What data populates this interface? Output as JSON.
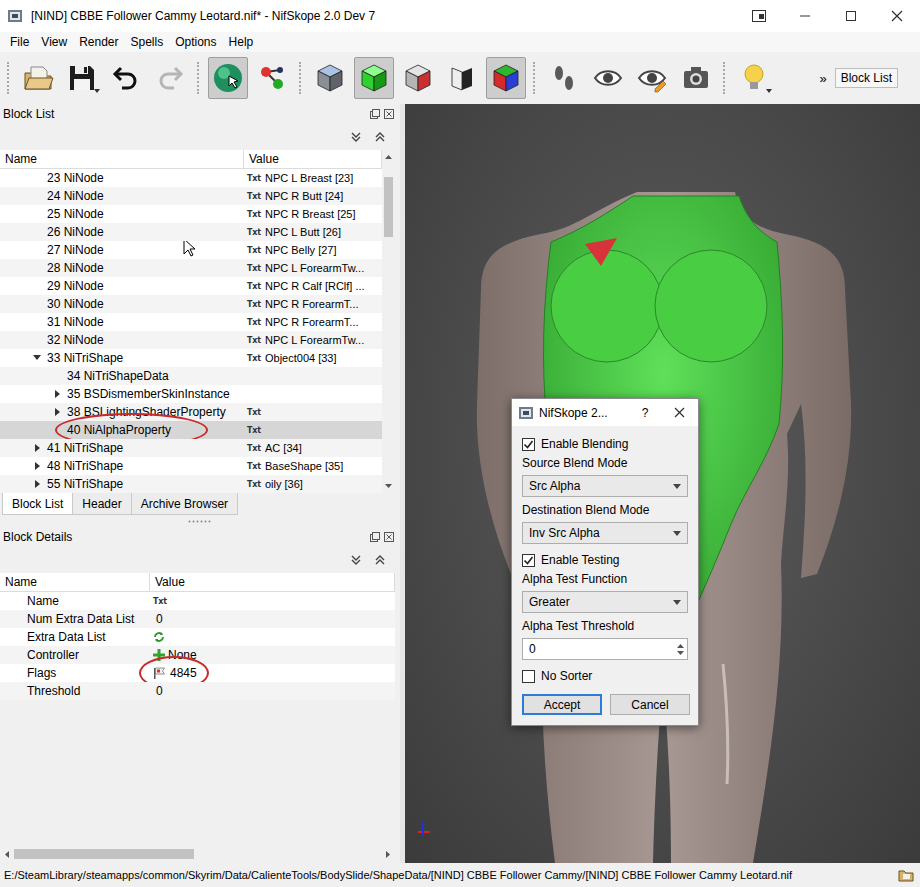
{
  "window": {
    "title": "[NIND] CBBE Follower Cammy Leotard.nif* - NifSkope 2.0 Dev 7"
  },
  "menu": [
    "File",
    "View",
    "Render",
    "Spells",
    "Options",
    "Help"
  ],
  "toolbar": {
    "items": [
      {
        "kind": "button",
        "pressed": false,
        "disabled": false
      },
      {
        "kind": "button",
        "pressed": false,
        "disabled": false
      },
      {
        "kind": "button",
        "pressed": false,
        "disabled": false
      },
      {
        "kind": "button",
        "pressed": false,
        "disabled": true
      },
      {
        "kind": "separator"
      },
      {
        "kind": "button",
        "pressed": true,
        "disabled": false
      },
      {
        "kind": "button",
        "pressed": false,
        "disabled": false
      },
      {
        "kind": "separator"
      },
      {
        "kind": "button",
        "pressed": false,
        "disabled": false
      },
      {
        "kind": "button",
        "pressed": true,
        "disabled": false
      },
      {
        "kind": "button",
        "pressed": false,
        "disabled": false
      },
      {
        "kind": "button",
        "pressed": false,
        "disabled": false
      },
      {
        "kind": "button",
        "pressed": true,
        "disabled": false
      },
      {
        "kind": "separator"
      },
      {
        "kind": "button",
        "pressed": false,
        "disabled": false
      },
      {
        "kind": "button",
        "pressed": false,
        "disabled": false
      },
      {
        "kind": "button",
        "pressed": false,
        "disabled": false
      },
      {
        "kind": "button",
        "pressed": false,
        "disabled": false
      },
      {
        "kind": "separator"
      },
      {
        "kind": "button",
        "pressed": false,
        "disabled": false
      }
    ],
    "overflow": "»",
    "dock_button": "Block List"
  },
  "block_list": {
    "title": "Block List",
    "columns": [
      "Name",
      "Value"
    ],
    "scroll_position": 0.05,
    "rows": [
      {
        "label": "23 NiNode",
        "value": "NPC L Breast [23]",
        "tag": "Txt",
        "depth": 1,
        "children": false,
        "selected": false,
        "highlighted": false
      },
      {
        "label": "24 NiNode",
        "value": "NPC R Butt [24]",
        "tag": "Txt",
        "depth": 1,
        "children": false,
        "selected": false,
        "highlighted": false
      },
      {
        "label": "25 NiNode",
        "value": "NPC R Breast [25]",
        "tag": "Txt",
        "depth": 1,
        "children": false,
        "selected": false,
        "highlighted": false
      },
      {
        "label": "26 NiNode",
        "value": "NPC L Butt [26]",
        "tag": "Txt",
        "depth": 1,
        "children": false,
        "selected": false,
        "highlighted": false
      },
      {
        "label": "27 NiNode",
        "value": "NPC Belly [27]",
        "tag": "Txt",
        "depth": 1,
        "children": false,
        "selected": false,
        "highlighted": false
      },
      {
        "label": "28 NiNode",
        "value": "NPC L ForearmTw...",
        "tag": "Txt",
        "depth": 1,
        "children": false,
        "selected": false,
        "highlighted": false
      },
      {
        "label": "29 NiNode",
        "value": "NPC R Calf [RClf] ...",
        "tag": "Txt",
        "depth": 1,
        "children": false,
        "selected": false,
        "highlighted": false
      },
      {
        "label": "30 NiNode",
        "value": "NPC R ForearmT...",
        "tag": "Txt",
        "depth": 1,
        "children": false,
        "selected": false,
        "highlighted": false
      },
      {
        "label": "31 NiNode",
        "value": "NPC R ForearmT...",
        "tag": "Txt",
        "depth": 1,
        "children": false,
        "selected": false,
        "highlighted": false
      },
      {
        "label": "32 NiNode",
        "value": "NPC L ForearmTw...",
        "tag": "Txt",
        "depth": 1,
        "children": false,
        "selected": false,
        "highlighted": false
      },
      {
        "label": "33 NiTriShape",
        "value": "Object004 [33]",
        "tag": "Txt",
        "depth": 1,
        "children": true,
        "expanded": true,
        "selected": false,
        "highlighted": false
      },
      {
        "label": "34 NiTriShapeData",
        "depth": 2,
        "children": false,
        "selected": false,
        "highlighted": false
      },
      {
        "label": "35 BSDismemberSkinInstance",
        "depth": 2,
        "children": true,
        "expanded": false,
        "selected": false,
        "highlighted": false
      },
      {
        "label": "38 BSLightingShaderProperty",
        "tag": "Txt",
        "depth": 2,
        "children": true,
        "expanded": false,
        "selected": false,
        "highlighted": false
      },
      {
        "label": "40 NiAlphaProperty",
        "tag": "Txt",
        "depth": 2,
        "children": false,
        "selected": true,
        "highlighted": true
      },
      {
        "label": "41 NiTriShape",
        "value": "AC [34]",
        "tag": "Txt",
        "depth": 1,
        "children": true,
        "expanded": false,
        "selected": false,
        "highlighted": false
      },
      {
        "label": "48 NiTriShape",
        "value": "BaseShape [35]",
        "tag": "Txt",
        "depth": 1,
        "children": true,
        "expanded": false,
        "selected": false,
        "highlighted": false
      },
      {
        "label": "55 NiTriShape",
        "value": "oily [36]",
        "tag": "Txt",
        "depth": 1,
        "children": true,
        "expanded": false,
        "selected": false,
        "highlighted": false
      }
    ]
  },
  "tabs": [
    {
      "label": "Block List",
      "selected": true
    },
    {
      "label": "Header",
      "selected": false
    },
    {
      "label": "Archive Browser",
      "selected": false
    }
  ],
  "block_details": {
    "title": "Block Details",
    "columns": [
      "Name",
      "Value"
    ],
    "scroll_position": 0,
    "rows": [
      {
        "name": "Name",
        "tag": "Txt",
        "kind": "text",
        "highlighted": false
      },
      {
        "name": "Num Extra Data List",
        "value": "0",
        "kind": "number",
        "highlighted": false
      },
      {
        "name": "Extra Data List",
        "kind": "list",
        "highlighted": false
      },
      {
        "name": "Controller",
        "value": "None",
        "kind": "link",
        "highlighted": false
      },
      {
        "name": "Flags",
        "value": "4845",
        "kind": "flags",
        "highlighted": true
      },
      {
        "name": "Threshold",
        "value": "0",
        "kind": "number",
        "highlighted": false
      }
    ]
  },
  "dialog": {
    "title": "NifSkope 2...",
    "help": "?",
    "fields": [
      {
        "kind": "checkbox",
        "label": "Enable Blending",
        "checked": true
      },
      {
        "kind": "combo",
        "label": "Source Blend Mode",
        "value": "Src Alpha"
      },
      {
        "kind": "combo",
        "label": "Destination Blend Mode",
        "value": "Inv Src Alpha"
      },
      {
        "kind": "checkbox",
        "label": "Enable Testing",
        "checked": true
      },
      {
        "kind": "combo",
        "label": "Alpha Test Function",
        "value": "Greater"
      },
      {
        "kind": "spin",
        "label": "Alpha Test Threshold",
        "value": "0"
      },
      {
        "kind": "checkbox",
        "label": "No Sorter",
        "checked": false
      }
    ],
    "buttons": [
      {
        "label": "Accept",
        "default": true
      },
      {
        "label": "Cancel",
        "default": false
      }
    ]
  },
  "status_bar": {
    "path": "E:/SteamLibrary/steamapps/common/Skyrim/Data/CalienteTools/BodySlide/ShapeData/[NIND] CBBE Follower Cammy/[NIND] CBBE Follower Cammy Leotard.nif"
  }
}
